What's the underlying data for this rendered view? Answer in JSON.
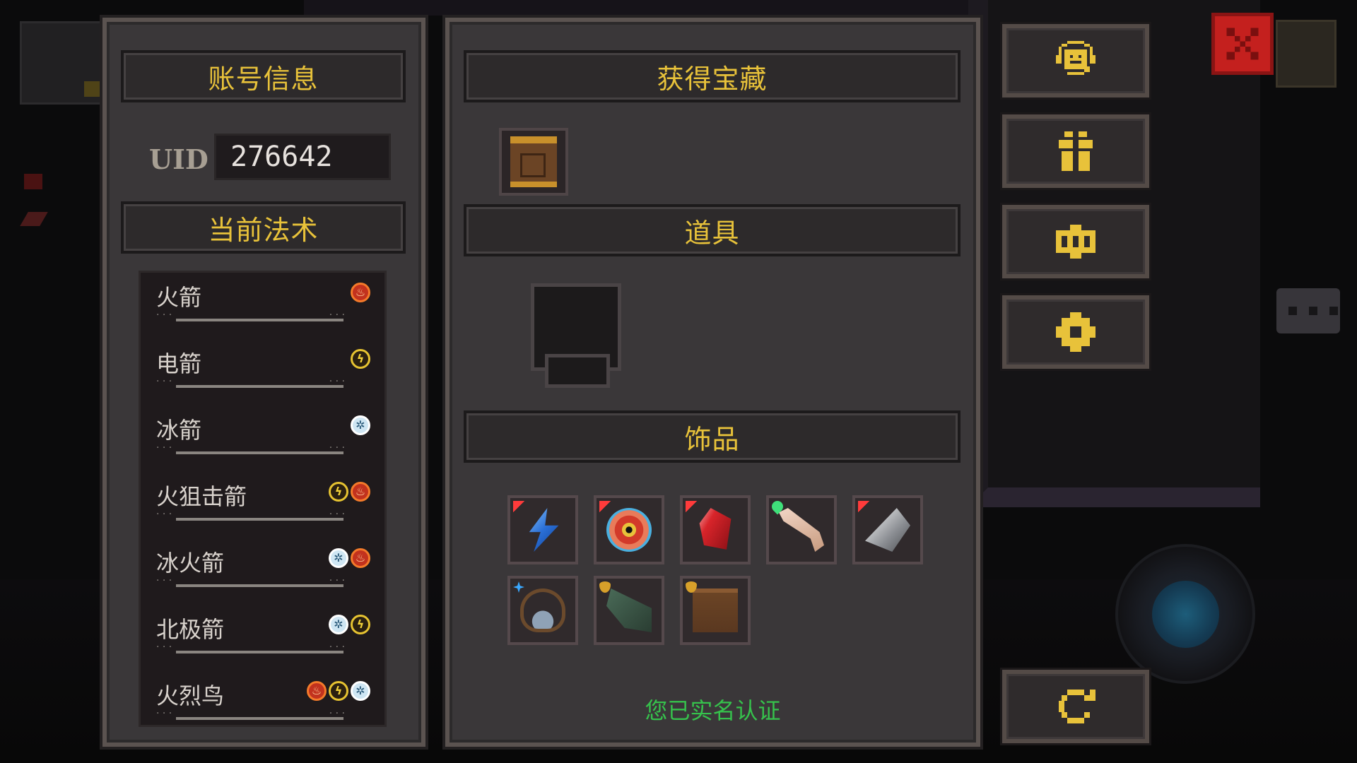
{
  "account_panel": {
    "title": "账号信息",
    "uid_label": "UID",
    "uid_value": "276642",
    "spells_title": "当前法术",
    "spells": [
      {
        "name": "火箭",
        "elements": [
          "fire"
        ]
      },
      {
        "name": "电箭",
        "elements": [
          "lightning"
        ]
      },
      {
        "name": "冰箭",
        "elements": [
          "ice"
        ]
      },
      {
        "name": "火狙击箭",
        "elements": [
          "lightning",
          "fire"
        ]
      },
      {
        "name": "冰火箭",
        "elements": [
          "ice",
          "fire"
        ]
      },
      {
        "name": "北极箭",
        "elements": [
          "ice",
          "lightning"
        ]
      },
      {
        "name": "火烈鸟",
        "elements": [
          "fire",
          "lightning",
          "ice"
        ]
      }
    ]
  },
  "loot_panel": {
    "treasure_title": "获得宝藏",
    "treasure_items": [
      {
        "icon": "scroll-icon"
      }
    ],
    "props_title": "道具",
    "props_items": [],
    "accessories_title": "饰品",
    "accessories": [
      {
        "icon": "blue-lightning-bolt-icon",
        "marker": "red-arrow"
      },
      {
        "icon": "archery-target-icon",
        "marker": "red-arrow"
      },
      {
        "icon": "red-crystal-icon",
        "marker": "red-arrow"
      },
      {
        "icon": "bone-wand-icon",
        "marker": "green-heart"
      },
      {
        "icon": "silver-arrowhead-icon",
        "marker": "red-arrow"
      },
      {
        "icon": "skull-necklace-icon",
        "marker": "blue-star"
      },
      {
        "icon": "green-claw-icon",
        "marker": "shield"
      },
      {
        "icon": "blue-rune-scroll-icon",
        "marker": "shield"
      }
    ],
    "verified_text": "您已实名认证"
  },
  "side_buttons": [
    {
      "icon": "customer-service-icon"
    },
    {
      "icon": "gift-icon"
    },
    {
      "icon": "code-redeem-icon"
    },
    {
      "icon": "settings-gear-icon"
    },
    {
      "icon": "refresh-icon"
    }
  ],
  "colors": {
    "title_gold": "#e8c23a",
    "verified_green": "#36c24c",
    "panel_bg": "#3a3739",
    "close_red": "#c4201e"
  }
}
